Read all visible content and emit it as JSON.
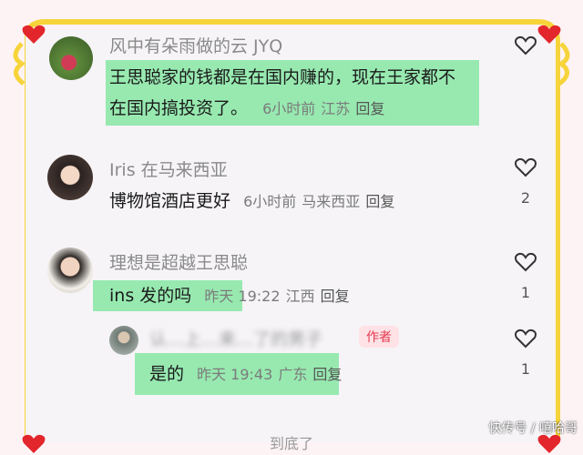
{
  "comments": [
    {
      "author": "风中有朵雨做的云 JYQ",
      "line1": "王思聪家的钱都是在国内赚的，现在王家都不",
      "line2": "在国内搞投资了。",
      "time": "6小时前",
      "location": "江苏",
      "reply": "回复"
    },
    {
      "author": "Iris 在马来西亚",
      "text": "博物馆酒店更好",
      "time": "6小时前",
      "location": "马来西亚",
      "reply": "回复",
      "likes": "2"
    },
    {
      "author": "理想是超越王思聪",
      "text": "ins 发的吗",
      "time": "昨天 19:22",
      "location": "江西",
      "reply": "回复",
      "likes": "1"
    },
    {
      "author": "认…上…来…了的男子",
      "author_tag": "作者",
      "text": "是的",
      "time": "昨天 19:43",
      "location": "广东",
      "reply": "回复",
      "likes": "1"
    }
  ],
  "footer_partial": "到底了",
  "watermark": "快传号 / 嘻哈哥",
  "colors": {
    "highlight": "#86e6a3",
    "frame_yellow": "#f6d43a",
    "heart_red": "#e2262c",
    "tag_red": "#e33a4f"
  }
}
